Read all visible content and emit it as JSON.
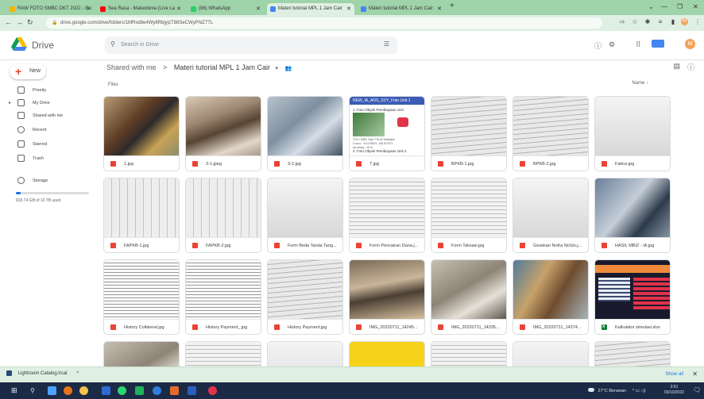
{
  "browser": {
    "tabs": [
      {
        "label": "RAW FOTO SMBC DKT 2022 - Go",
        "active": false,
        "favicon_color": "#f4b400"
      },
      {
        "label": "Sea Rasa - Makedonia (Live La",
        "active": false,
        "favicon_color": "#ff0000"
      },
      {
        "label": "(86) WhatsApp",
        "active": false,
        "favicon_color": "#25d366"
      },
      {
        "label": "Materi tutorial MPL 1 Jam Cair",
        "active": true,
        "favicon_color": "#4285f4"
      },
      {
        "label": "Materi tutorial MPL 1 Jam Cair",
        "active": false,
        "favicon_color": "#4285f4"
      }
    ],
    "new_tab": "+",
    "url": "drive.google.com/drive/folders/1MRsd8e4Wy8RbjyjzT88SeCWyPhlZ7TL"
  },
  "drive": {
    "product_name": "Drive",
    "search_placeholder": "Search in Drive",
    "avatar_initial": "M",
    "new_button": "New",
    "sidebar": [
      {
        "label": "Priority",
        "icon": "priority-icon"
      },
      {
        "label": "My Drive",
        "icon": "my-drive-icon"
      },
      {
        "label": "Shared with me",
        "icon": "shared-icon"
      },
      {
        "label": "Recent",
        "icon": "clock-icon"
      },
      {
        "label": "Starred",
        "icon": "star-icon"
      },
      {
        "label": "Trash",
        "icon": "trash-icon"
      },
      {
        "label": "Storage",
        "icon": "cloud-icon"
      }
    ],
    "storage_text": "633.74 GB of 10 TB used",
    "storage_fraction": 0.062,
    "breadcrumb": {
      "root": "Shared with me",
      "separator": ">",
      "current": "Materi tutorial MPL 1 Jam Cair"
    },
    "files_label": "Files",
    "sort_label": "Name ↑",
    "files": [
      {
        "name": "1.jpg",
        "type": "image",
        "thumb": "t-photo-a"
      },
      {
        "name": "3-1.jpeg",
        "type": "image",
        "thumb": "t-photo-b"
      },
      {
        "name": "3-2.jpg",
        "type": "image",
        "thumb": "t-photo-c"
      },
      {
        "name": "7.jpg",
        "type": "image",
        "thumb": "t-app"
      },
      {
        "name": "BPKB-1.jpg",
        "type": "image",
        "thumb": "t-doc3"
      },
      {
        "name": "BPKB-2.jpg",
        "type": "image",
        "thumb": "t-doc3"
      },
      {
        "name": "Faktur.jpg",
        "type": "image",
        "thumb": "t-docgray"
      },
      {
        "name": "FAPKB-1.jpg",
        "type": "image",
        "thumb": "t-doc2"
      },
      {
        "name": "FAPKB-2.jpg",
        "type": "image",
        "thumb": "t-doc2"
      },
      {
        "name": "Form Beda Tanda Tang...",
        "type": "image",
        "thumb": "t-docgray"
      },
      {
        "name": "Form Pencairan Dana.j...",
        "type": "image",
        "thumb": "t-doc"
      },
      {
        "name": "Form Taksasi.jpg",
        "type": "image",
        "thumb": "t-doc"
      },
      {
        "name": "Gesekan NoKa NoSin.j...",
        "type": "image",
        "thumb": "t-docgray"
      },
      {
        "name": "HASIL MBIZ - IA.jpg",
        "type": "image",
        "thumb": "t-photo-g"
      },
      {
        "name": "History Collateral.jpg",
        "type": "image",
        "thumb": "t-table"
      },
      {
        "name": "History Payment_.jpg",
        "type": "image",
        "thumb": "t-table"
      },
      {
        "name": "History Payment.jpg",
        "type": "image",
        "thumb": "t-doc3"
      },
      {
        "name": "IMG_20220711_14245...",
        "type": "image",
        "thumb": "t-photo-d"
      },
      {
        "name": "IMG_20220711_14335...",
        "type": "image",
        "thumb": "t-photo-e"
      },
      {
        "name": "IMG_20220711_14374...",
        "type": "image",
        "thumb": "t-photo-f"
      },
      {
        "name": "Kalkulator simulasi.xlsx",
        "type": "sheet",
        "thumb": "t-sheet"
      },
      {
        "name": "",
        "type": "image",
        "thumb": "t-photo-e"
      },
      {
        "name": "",
        "type": "image",
        "thumb": "t-doc"
      },
      {
        "name": "",
        "type": "image",
        "thumb": "t-docgray"
      },
      {
        "name": "",
        "type": "image",
        "thumb": "t-yellow"
      },
      {
        "name": "",
        "type": "image",
        "thumb": "t-doc"
      },
      {
        "name": "",
        "type": "image",
        "thumb": "t-docgray"
      },
      {
        "name": "",
        "type": "image",
        "thumb": "t-doc3"
      }
    ],
    "app_thumb": {
      "header": "NEW_IA_AOS_SVY_Foto Unit 1",
      "line1": "1. Foto Obyek Pembiayaan Unit",
      "details": "720 x 1280, Size 776.42 Kilobytes\nCoord : -6.4178022, 106.672071\nAccuracy : 15 m",
      "line3": "2. Foto Obyek Pembiayaan Unit 2"
    }
  },
  "downloads": {
    "item": "Lightroom Catalog.lrcat",
    "show_all": "Show all"
  },
  "taskbar": {
    "weather": "27°C  Berawan",
    "time": "3:51",
    "date": "03/10/2022"
  }
}
